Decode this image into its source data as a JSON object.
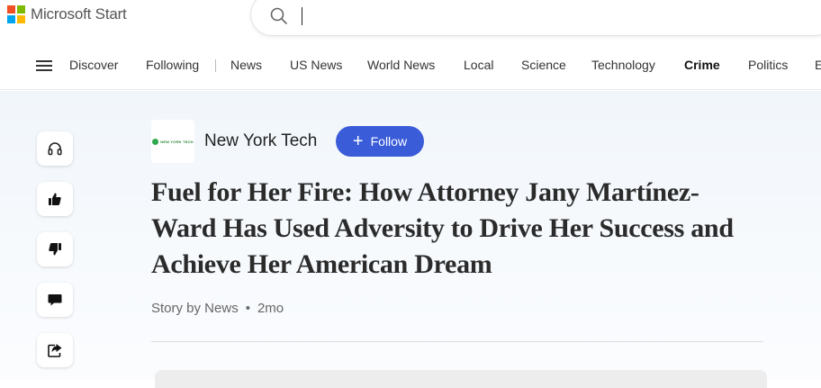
{
  "header": {
    "brand": "Microsoft Start",
    "search": {
      "value": "",
      "placeholder": ""
    }
  },
  "nav": {
    "items": [
      {
        "label": "Discover"
      },
      {
        "label": "Following"
      },
      {
        "label": "News"
      },
      {
        "label": "US News"
      },
      {
        "label": "World News"
      },
      {
        "label": "Local"
      },
      {
        "label": "Science"
      },
      {
        "label": "Technology"
      },
      {
        "label": "Crime",
        "active": true
      },
      {
        "label": "Politics"
      },
      {
        "label": "E"
      }
    ]
  },
  "rail": {
    "icons": [
      "headphones-icon",
      "thumbs-up-icon",
      "thumbs-down-icon",
      "comment-icon",
      "share-icon"
    ]
  },
  "article": {
    "publisher_logo_text": "NEW YORK TECH",
    "publisher": "New York Tech",
    "follow_label": "Follow",
    "headline": "Fuel for Her Fire: How Attorney Jany Martínez-Ward Has Used Adversity to Drive Her Success and Achieve Her American Dream",
    "byline": "Story by News",
    "age": "2mo"
  },
  "colors": {
    "accent": "#3a5cd8",
    "content_bg": "#f1f6fb"
  }
}
